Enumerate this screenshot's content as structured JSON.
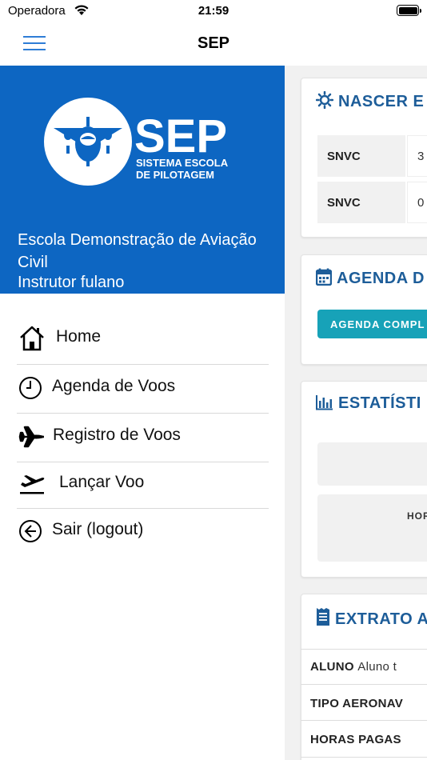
{
  "status_bar": {
    "carrier": "Operadora",
    "time": "21:59"
  },
  "navbar": {
    "title": "SEP"
  },
  "drawer": {
    "logo": {
      "big_text": "SEP",
      "subtitle_line1": "SISTEMA ESCOLA",
      "subtitle_line2": "DE PILOTAGEM"
    },
    "school_name": "Escola Demonstração de Aviação Civil",
    "instructor": "Instrutor fulano",
    "menu": [
      {
        "label": "Home",
        "icon": "home-icon"
      },
      {
        "label": "Agenda de Voos",
        "icon": "clock-icon"
      },
      {
        "label": "Registro de Voos",
        "icon": "airplane-icon"
      },
      {
        "label": "Lançar Voo",
        "icon": "takeoff-icon"
      },
      {
        "label": "Sair (logout)",
        "icon": "arrow-left-circle-icon"
      }
    ]
  },
  "main": {
    "sunrise_card": {
      "title": "NASCER E",
      "rows": [
        {
          "label": "SNVC",
          "value": "3"
        },
        {
          "label": "SNVC",
          "value": "0"
        }
      ]
    },
    "agenda_card": {
      "title": "AGENDA D",
      "button": "AGENDA COMPL"
    },
    "stats_card": {
      "title": "ESTATÍSTI",
      "label": "HOR"
    },
    "extract_card": {
      "title": "EXTRATO A",
      "rows": [
        {
          "label": "ALUNO",
          "value": "Aluno t"
        },
        {
          "label": "TIPO AERONAV",
          "value": ""
        },
        {
          "label": "HORAS PAGAS",
          "value": ""
        }
      ]
    }
  },
  "colors": {
    "brand_blue": "#0d66c2",
    "title_blue": "#1d5d99",
    "teal": "#17a2b8",
    "hamburger_blue": "#2e7dd6"
  }
}
